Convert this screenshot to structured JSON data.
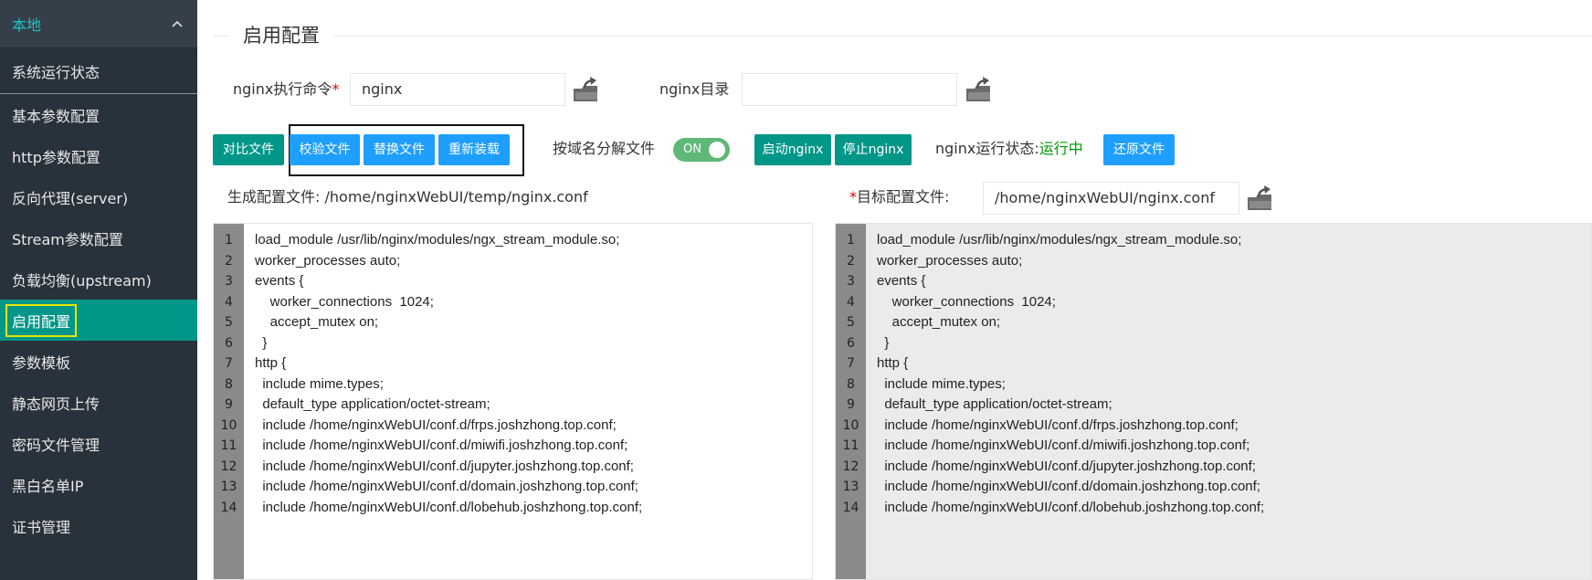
{
  "sidebar": {
    "header": "本地",
    "items": [
      {
        "label": "系统运行状态",
        "name": "sidebar-item-system-status"
      },
      {
        "label": "基本参数配置",
        "name": "sidebar-item-basic-params"
      },
      {
        "label": "http参数配置",
        "name": "sidebar-item-http-params"
      },
      {
        "label": "反向代理(server)",
        "name": "sidebar-item-reverse-proxy"
      },
      {
        "label": "Stream参数配置",
        "name": "sidebar-item-stream-params"
      },
      {
        "label": "负载均衡(upstream)",
        "name": "sidebar-item-upstream"
      },
      {
        "label": "启用配置",
        "name": "sidebar-item-enable-config",
        "active": true
      },
      {
        "label": "参数模板",
        "name": "sidebar-item-param-template"
      },
      {
        "label": "静态网页上传",
        "name": "sidebar-item-static-upload"
      },
      {
        "label": "密码文件管理",
        "name": "sidebar-item-password-files"
      },
      {
        "label": "黑白名单IP",
        "name": "sidebar-item-ip-list"
      },
      {
        "label": "证书管理",
        "name": "sidebar-item-cert-manage"
      }
    ]
  },
  "page": {
    "title": "启用配置"
  },
  "form": {
    "cmd_label": "nginx执行命令",
    "required_mark": "*",
    "cmd_value": "nginx",
    "dir_label": "nginx目录",
    "dir_value": ""
  },
  "toolbar": {
    "compare": "对比文件",
    "check": "校验文件",
    "replace": "替换文件",
    "reload": "重新装载",
    "split_label": "按域名分解文件",
    "toggle_text": "ON",
    "start": "启动nginx",
    "stop": "停止nginx",
    "status_label": "nginx运行状态:",
    "status_value": "运行中",
    "restore": "还原文件"
  },
  "files": {
    "generated_label": "生成配置文件:",
    "generated_path": "/home/nginxWebUI/temp/nginx.conf",
    "target_required": "*",
    "target_label": "目标配置文件:",
    "target_path": "/home/nginxWebUI/nginx.conf"
  },
  "code_lines": [
    "load_module /usr/lib/nginx/modules/ngx_stream_module.so;",
    "worker_processes auto;",
    "events {",
    "    worker_connections  1024;",
    "    accept_mutex on;",
    "  }",
    "http {",
    "  include mime.types;",
    "  default_type application/octet-stream;",
    "  include /home/nginxWebUI/conf.d/frps.joshzhong.top.conf;",
    "  include /home/nginxWebUI/conf.d/miwifi.joshzhong.top.conf;",
    "  include /home/nginxWebUI/conf.d/jupyter.joshzhong.top.conf;",
    "  include /home/nginxWebUI/conf.d/domain.joshzhong.top.conf;",
    "  include /home/nginxWebUI/conf.d/lobehub.joshzhong.top.conf;"
  ],
  "colors": {
    "accent": "#009688",
    "blue": "#1e9fff",
    "sidebar": "#28323c",
    "toggle_on": "#5fb878",
    "status_ok": "#009900"
  }
}
